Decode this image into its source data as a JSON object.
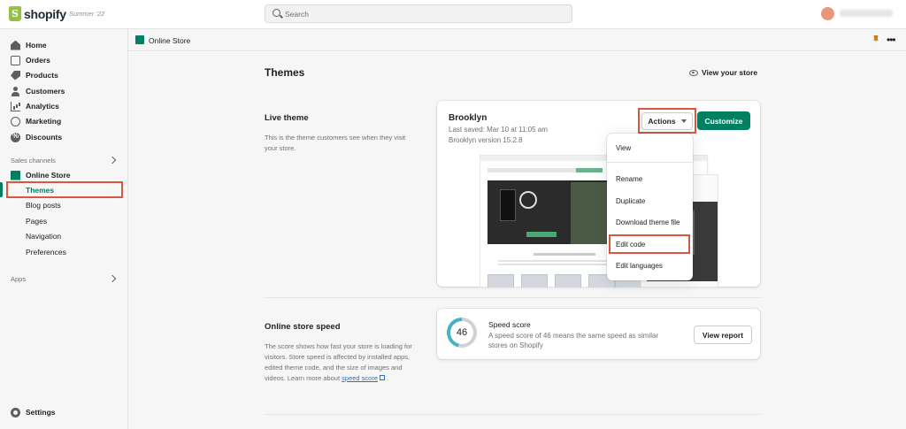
{
  "topbar": {
    "brand": "shopify",
    "badge": "Summer '22",
    "search_placeholder": "Search"
  },
  "sidebar": {
    "main_items": [
      {
        "label": "Home",
        "icon": "home-icon"
      },
      {
        "label": "Orders",
        "icon": "orders-icon"
      },
      {
        "label": "Products",
        "icon": "tag-icon"
      },
      {
        "label": "Customers",
        "icon": "person-icon"
      },
      {
        "label": "Analytics",
        "icon": "bar-chart-icon"
      },
      {
        "label": "Marketing",
        "icon": "target-icon"
      },
      {
        "label": "Discounts",
        "icon": "discount-icon"
      }
    ],
    "sales_channels_label": "Sales channels",
    "online_store_label": "Online Store",
    "sub_items": [
      "Themes",
      "Blog posts",
      "Pages",
      "Navigation",
      "Preferences"
    ],
    "active_sub_item": "Themes",
    "apps_label": "Apps",
    "settings_label": "Settings"
  },
  "breadcrumb": {
    "label": "Online Store"
  },
  "main": {
    "title": "Themes",
    "view_store_label": "View your store",
    "live_theme": {
      "heading": "Live theme",
      "description": "This is the theme customers see when they visit your store.",
      "theme_name": "Brooklyn",
      "last_saved": "Last saved: Mar 10 at 11:05 am",
      "version": "Brooklyn version 15.2.8",
      "actions_label": "Actions",
      "customize_label": "Customize"
    },
    "actions_menu": {
      "items": [
        "View",
        "Rename",
        "Duplicate",
        "Download theme file",
        "Edit code",
        "Edit languages"
      ],
      "highlighted": "Edit code"
    },
    "speed": {
      "heading": "Online store speed",
      "description": "The score shows how fast your store is loading for visitors. Store speed is affected by installed apps, edited theme code, and the size of images and videos. Learn more about",
      "link_label": "speed score",
      "trailing": ".",
      "score": 46,
      "score_max": 100,
      "card_title": "Speed score",
      "card_desc": "A speed score of 46 means the same speed as similar stores on Shopify",
      "report_label": "View report"
    }
  },
  "colors": {
    "brand_green": "#008060",
    "shopify_green": "#95bf47",
    "highlight_red": "#d9573f",
    "gauge_teal": "#44b3c2",
    "link_blue": "#2c6ecb"
  }
}
